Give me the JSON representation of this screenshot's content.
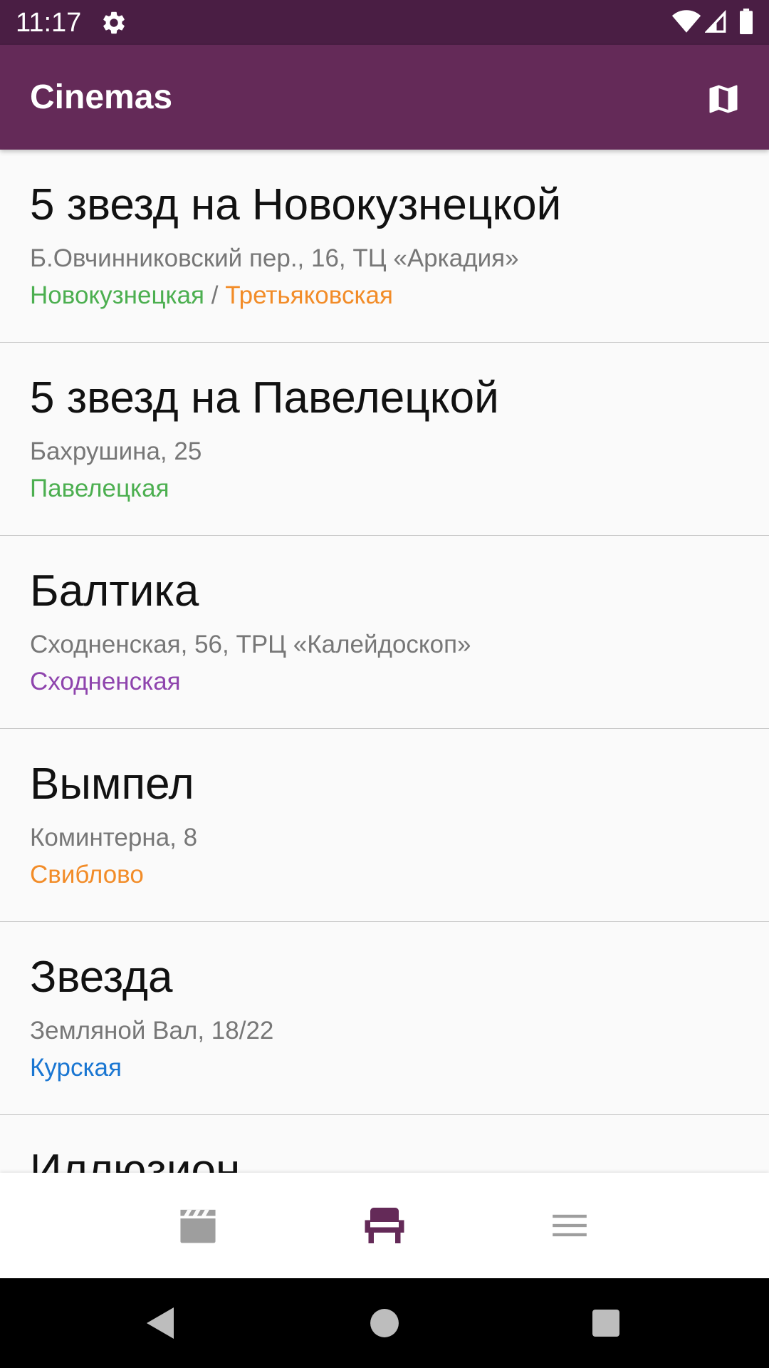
{
  "status_bar": {
    "time": "11:17",
    "icons": [
      "gear-icon",
      "wifi-icon",
      "signal-icon",
      "battery-icon"
    ]
  },
  "app_bar": {
    "title": "Cinemas",
    "action_icon": "map-icon"
  },
  "cinemas": [
    {
      "name": "5 звезд на Новокузнецкой",
      "address": "Б.Овчинниковский пер., 16, ТЦ «Аркадия»",
      "metro": [
        {
          "station": "Новокузнецкая",
          "color": "#4caf50"
        },
        {
          "station": "Третьяковская",
          "color": "#f28c28"
        }
      ],
      "separator": " / "
    },
    {
      "name": "5 звезд на Павелецкой",
      "address": "Бахрушина, 25",
      "metro": [
        {
          "station": "Павелецкая",
          "color": "#4caf50"
        }
      ]
    },
    {
      "name": "Балтика",
      "address": "Сходненская, 56, ТРЦ «Калейдоскоп»",
      "metro": [
        {
          "station": "Сходненская",
          "color": "#8e44ad"
        }
      ]
    },
    {
      "name": "Вымпел",
      "address": "Коминтерна, 8",
      "metro": [
        {
          "station": "Свиблово",
          "color": "#f28c28"
        }
      ]
    },
    {
      "name": "Звезда",
      "address": "Земляной Вал, 18/22",
      "metro": [
        {
          "station": "Курская",
          "color": "#1976d2"
        }
      ]
    },
    {
      "name": "Иллюзион",
      "address": "",
      "metro": []
    }
  ],
  "bottom_nav": {
    "items": [
      {
        "icon": "clapperboard-icon",
        "active": false
      },
      {
        "icon": "cinema-seat-icon",
        "active": true
      },
      {
        "icon": "menu-icon",
        "active": false
      }
    ],
    "active_color": "#642a58",
    "inactive_color": "#9e9e9e"
  },
  "system_nav": {
    "icons": [
      "back-icon",
      "home-icon",
      "recents-icon"
    ]
  },
  "colors": {
    "status_bar": "#4a1e44",
    "app_bar": "#642a58",
    "background": "#fafafa"
  }
}
